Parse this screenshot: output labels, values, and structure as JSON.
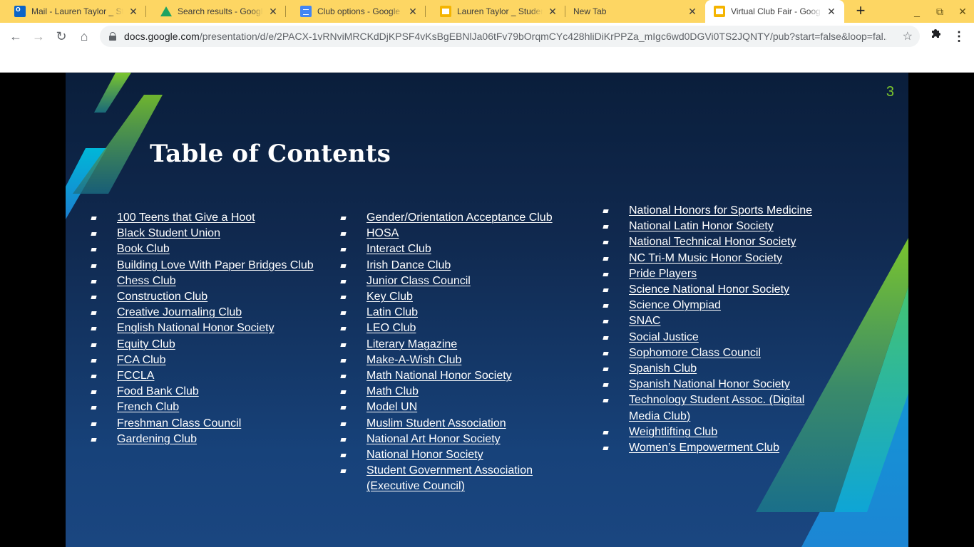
{
  "browser": {
    "tabs": [
      {
        "title": "Mail - Lauren Taylor _ Student",
        "icon": "outlook-icon",
        "active": false
      },
      {
        "title": "Search results - Google Drive",
        "icon": "google-drive-icon",
        "active": false
      },
      {
        "title": "Club options - Google Docs",
        "icon": "google-docs-icon",
        "active": false
      },
      {
        "title": "Lauren Taylor _ Student - Google Slides",
        "icon": "google-slides-icon",
        "active": false
      },
      {
        "title": "New Tab",
        "icon": "",
        "active": false
      },
      {
        "title": "Virtual Club Fair - Google Slides",
        "icon": "google-slides-icon",
        "active": true
      }
    ],
    "new_tab_label": "+",
    "window_controls": {
      "minimize": "_",
      "restore": "⧉",
      "close": "✕"
    },
    "address_bar": {
      "host": "docs.google.com",
      "path": "/presentation/d/e/2PACX-1vRNviMRCKdDjKPSF4vKsBgEBNlJa06tFv79bOrqmCYc428hliDiKrPPZa_mIgc6wd0DGVi0TS2JQNTY/pub?start=false&loop=fal..."
    }
  },
  "slide": {
    "number": "3",
    "title": "Table of Contents",
    "accent_color": "#7ac52d",
    "columns": [
      [
        "100 Teens that Give a Hoot",
        "Black Student Union",
        "Book Club",
        "Building Love With Paper Bridges Club",
        "Chess Club",
        "Construction Club",
        "Creative Journaling Club",
        "English National Honor Society",
        "Equity Club",
        "FCA Club",
        "FCCLA",
        "Food Bank Club",
        "French Club",
        "Freshman Class Council",
        "Gardening Club"
      ],
      [
        "Gender/Orientation Acceptance  Club",
        "HOSA",
        "Interact Club",
        "Irish Dance Club",
        "Junior Class Council",
        "Key Club",
        "Latin Club",
        "LEO Club",
        "Literary Magazine",
        "Make-A-Wish Club",
        "Math National Honor Society",
        "Math Club",
        "Model UN",
        "Muslim Student Association",
        "National Art Honor Society",
        "National Honor Society",
        "Student Government Association (Executive Council)"
      ],
      [
        "National Honors for Sports Medicine",
        "National Latin Honor Society",
        "National Technical Honor Society",
        "NC Tri-M Music Honor Society",
        "Pride Players",
        "Science National Honor Society",
        "Science Olympiad",
        "SNAC",
        "Social Justice",
        "Sophomore Class Council",
        "Spanish Club",
        "Spanish National Honor Society",
        "Technology Student Assoc. (Digital Media Club)",
        "Weightlifting Club",
        "Women’s Empowerment Club"
      ]
    ]
  }
}
